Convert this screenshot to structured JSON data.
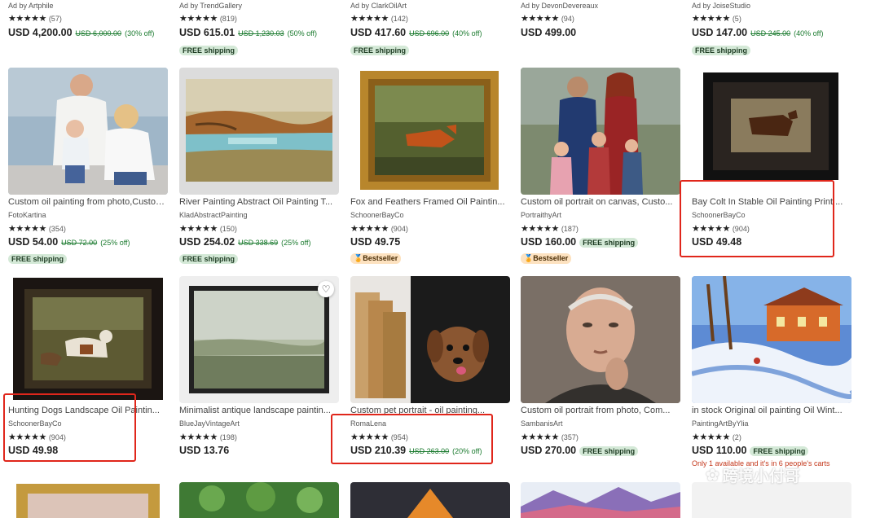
{
  "top_row": [
    {
      "ad": "Ad by Artphile",
      "stars": "★★★★★",
      "count": "(57)",
      "price": "USD 4,200.00",
      "orig": "USD 6,000.00",
      "disc": "(30% off)",
      "badge": ""
    },
    {
      "ad": "Ad by TrendGallery",
      "stars": "★★★★★",
      "count": "(819)",
      "price": "USD 615.01",
      "orig": "USD 1,230.03",
      "disc": "(50% off)",
      "badge": "FREE shipping"
    },
    {
      "ad": "Ad by ClarkOilArt",
      "stars": "★★★★★",
      "count": "(142)",
      "price": "USD 417.60",
      "orig": "USD 696.00",
      "disc": "(40% off)",
      "badge": "FREE shipping"
    },
    {
      "ad": "Ad by DevonDevereaux",
      "stars": "★★★★★",
      "count": "(94)",
      "price": "USD 499.00",
      "orig": "",
      "disc": "",
      "badge": ""
    },
    {
      "ad": "Ad by JoiseStudio",
      "stars": "★★★★★",
      "count": "(5)",
      "price": "USD 147.00",
      "orig": "USD 245.00",
      "disc": "(40% off)",
      "badge": "FREE shipping"
    }
  ],
  "row2": [
    {
      "title": "Custom oil painting from photo,Custom...",
      "shop": "FotoKartina",
      "stars": "★★★★★",
      "count": "(354)",
      "price": "USD 54.00",
      "orig": "USD 72.00",
      "disc": "(25% off)",
      "badge": "FREE shipping"
    },
    {
      "title": "River Painting Abstract Oil Painting T...",
      "shop": "KladAbstractPainting",
      "stars": "★★★★★",
      "count": "(150)",
      "price": "USD 254.02",
      "orig": "USD 338.69",
      "disc": "(25% off)",
      "badge": "FREE shipping"
    },
    {
      "title": "Fox and Feathers Framed Oil Paintin...",
      "shop": "SchoonerBayCo",
      "stars": "★★★★★",
      "count": "(904)",
      "price": "USD 49.75",
      "orig": "",
      "disc": "",
      "badge": "Bestseller"
    },
    {
      "title": "Custom oil portrait on canvas, Custo...",
      "shop": "PortraithyArt",
      "stars": "★★★★★",
      "count": "(187)",
      "price": "USD 160.00",
      "orig": "",
      "disc": "",
      "badge": "Bestseller",
      "inline_badge": "FREE shipping"
    },
    {
      "title": "Bay Colt In Stable Oil Painting Print ...",
      "shop": "SchoonerBayCo",
      "stars": "★★★★★",
      "count": "(904)",
      "price": "USD 49.48",
      "orig": "",
      "disc": "",
      "badge": ""
    }
  ],
  "row3": [
    {
      "title": "Hunting Dogs Landscape Oil Paintin...",
      "shop": "SchoonerBayCo",
      "stars": "★★★★★",
      "count": "(904)",
      "price": "USD 49.98",
      "orig": "",
      "disc": "",
      "badge": ""
    },
    {
      "title": "Minimalist antique landscape paintin...",
      "shop": "BlueJayVintageArt",
      "stars": "★★★★★",
      "count": "(198)",
      "price": "USD 13.76",
      "orig": "",
      "disc": "",
      "badge": ""
    },
    {
      "title": "Custom pet portrait - oil painting...",
      "shop": "RomaLena",
      "stars": "★★★★★",
      "count": "(954)",
      "price": "USD 210.39",
      "orig": "USD 263.00",
      "disc": "(20% off)",
      "badge": ""
    },
    {
      "title": "Custom oil portrait from photo, Com...",
      "shop": "SambanisArt",
      "stars": "★★★★★",
      "count": "(357)",
      "price": "USD 270.00",
      "orig": "",
      "disc": "",
      "badge": "",
      "inline_badge": "FREE shipping"
    },
    {
      "title": "in stock Original oil painting Oil Wint...",
      "shop": "PaintingArtByYlia",
      "stars": "★★★★★",
      "count": "(2)",
      "price": "USD 110.00",
      "orig": "",
      "disc": "",
      "badge": "",
      "inline_badge": "FREE shipping",
      "urgent": "Only 1 available and it's in 6 people's carts"
    }
  ],
  "watermark": "跨境小付哥",
  "favorite_glyph": "♡",
  "wechat_glyph": "✿"
}
